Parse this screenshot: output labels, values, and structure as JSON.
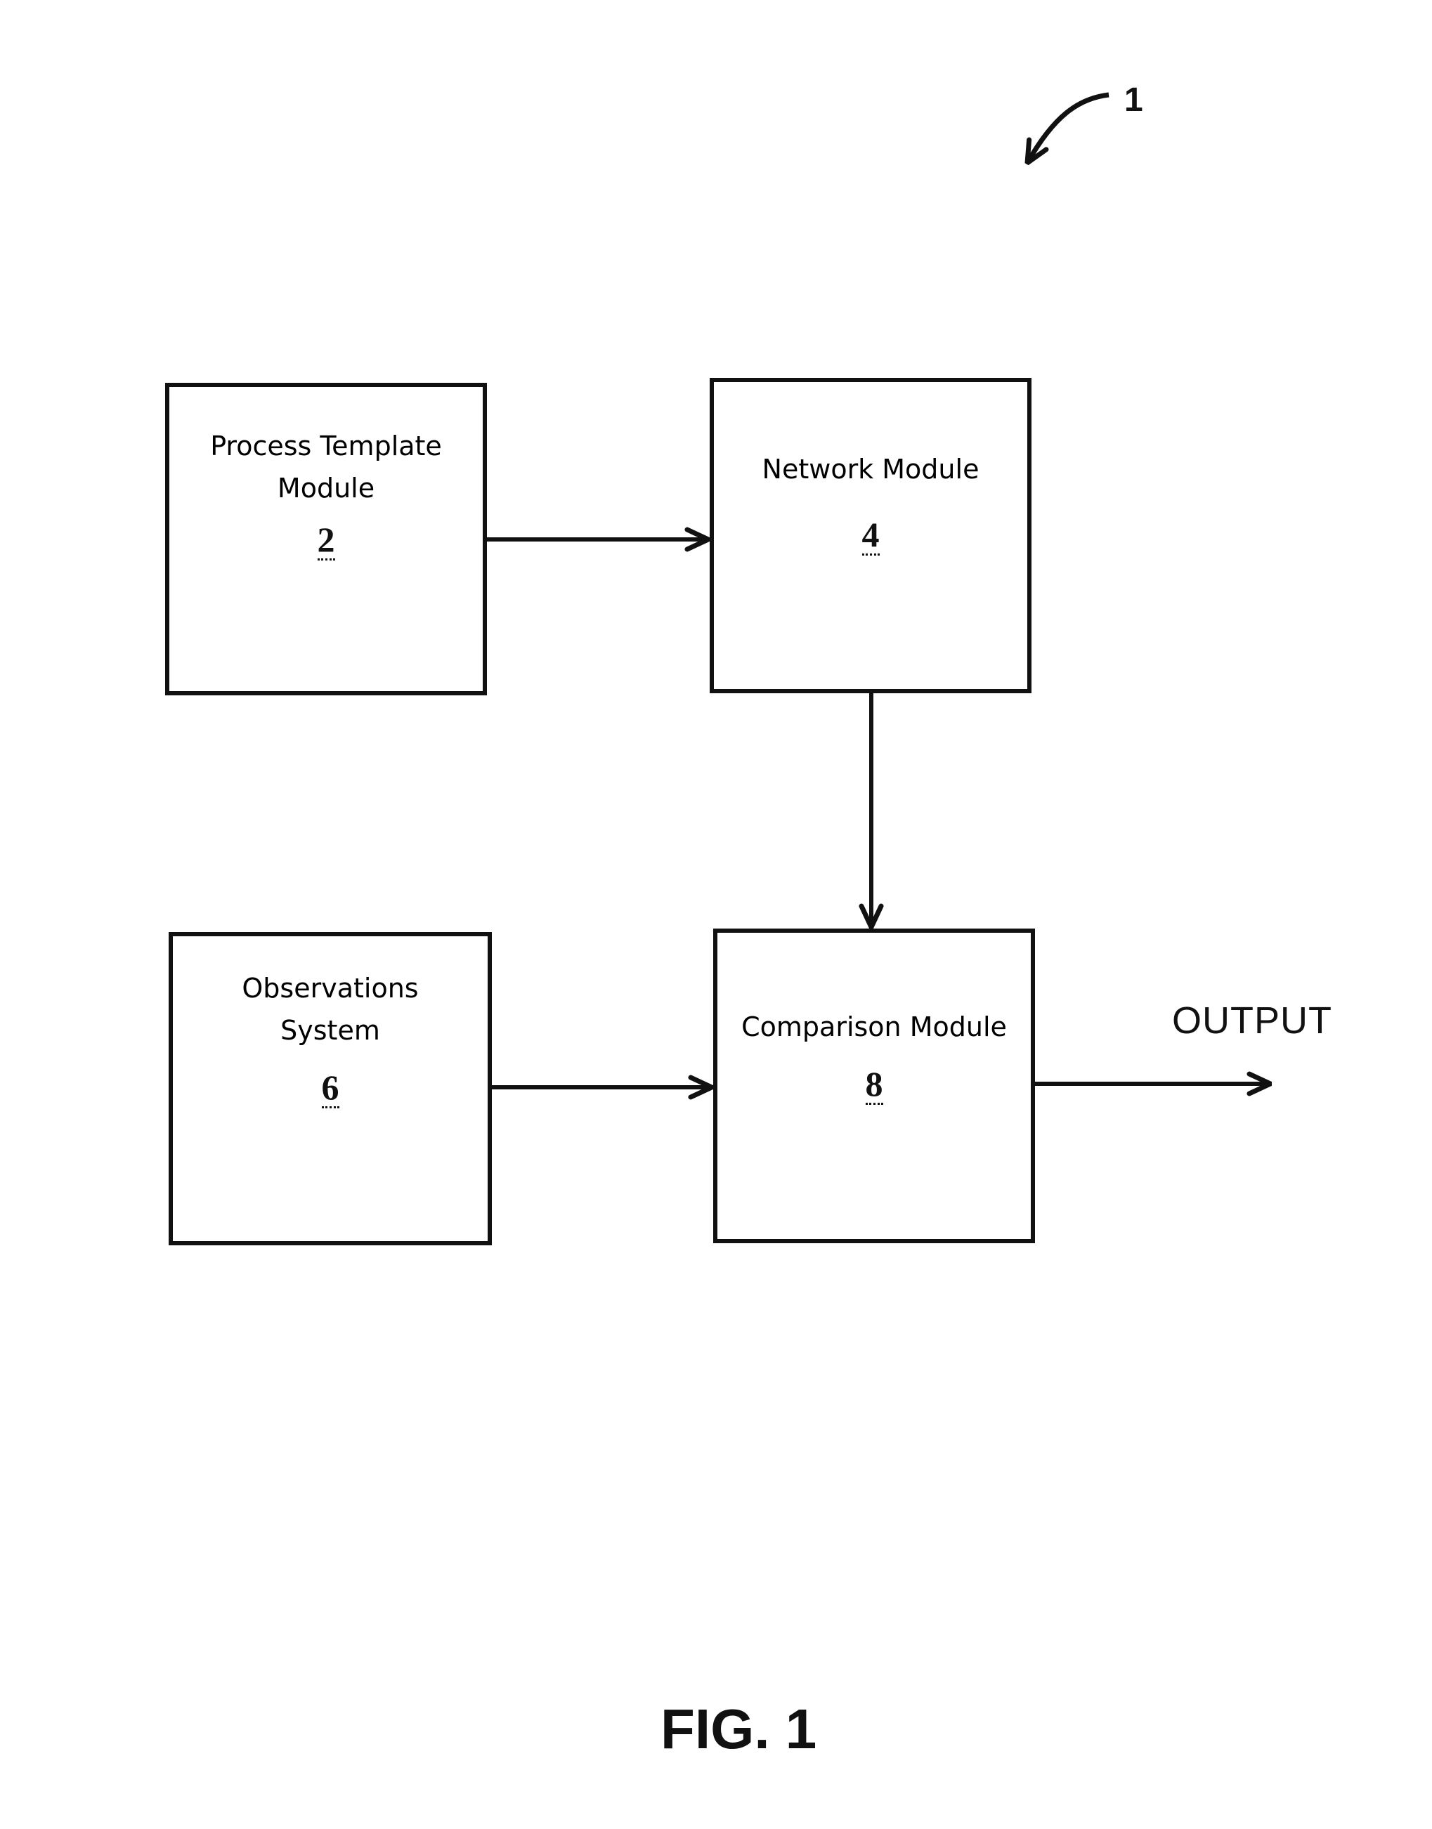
{
  "figure": {
    "reference_numeral": "1",
    "caption": "FIG. 1",
    "output_label": "OUTPUT"
  },
  "modules": [
    {
      "id": "process-template-module",
      "label_lines": [
        "Process Template",
        "Module"
      ],
      "ref": "2"
    },
    {
      "id": "network-module",
      "label_lines": [
        "Network Module"
      ],
      "ref": "4"
    },
    {
      "id": "observations-system",
      "label_lines": [
        "Observations",
        "System"
      ],
      "ref": "6"
    },
    {
      "id": "comparison-module",
      "label_lines": [
        "Comparison Module"
      ],
      "ref": "8"
    }
  ],
  "connections": [
    {
      "from": "Process Template Module (2)",
      "to": "Network Module (4)"
    },
    {
      "from": "Network Module (4)",
      "to": "Comparison Module (8)"
    },
    {
      "from": "Observations System (6)",
      "to": "Comparison Module (8)"
    },
    {
      "from": "Comparison Module (8)",
      "to": "OUTPUT"
    }
  ],
  "colors": {
    "line": "#111111",
    "background": "#ffffff"
  }
}
